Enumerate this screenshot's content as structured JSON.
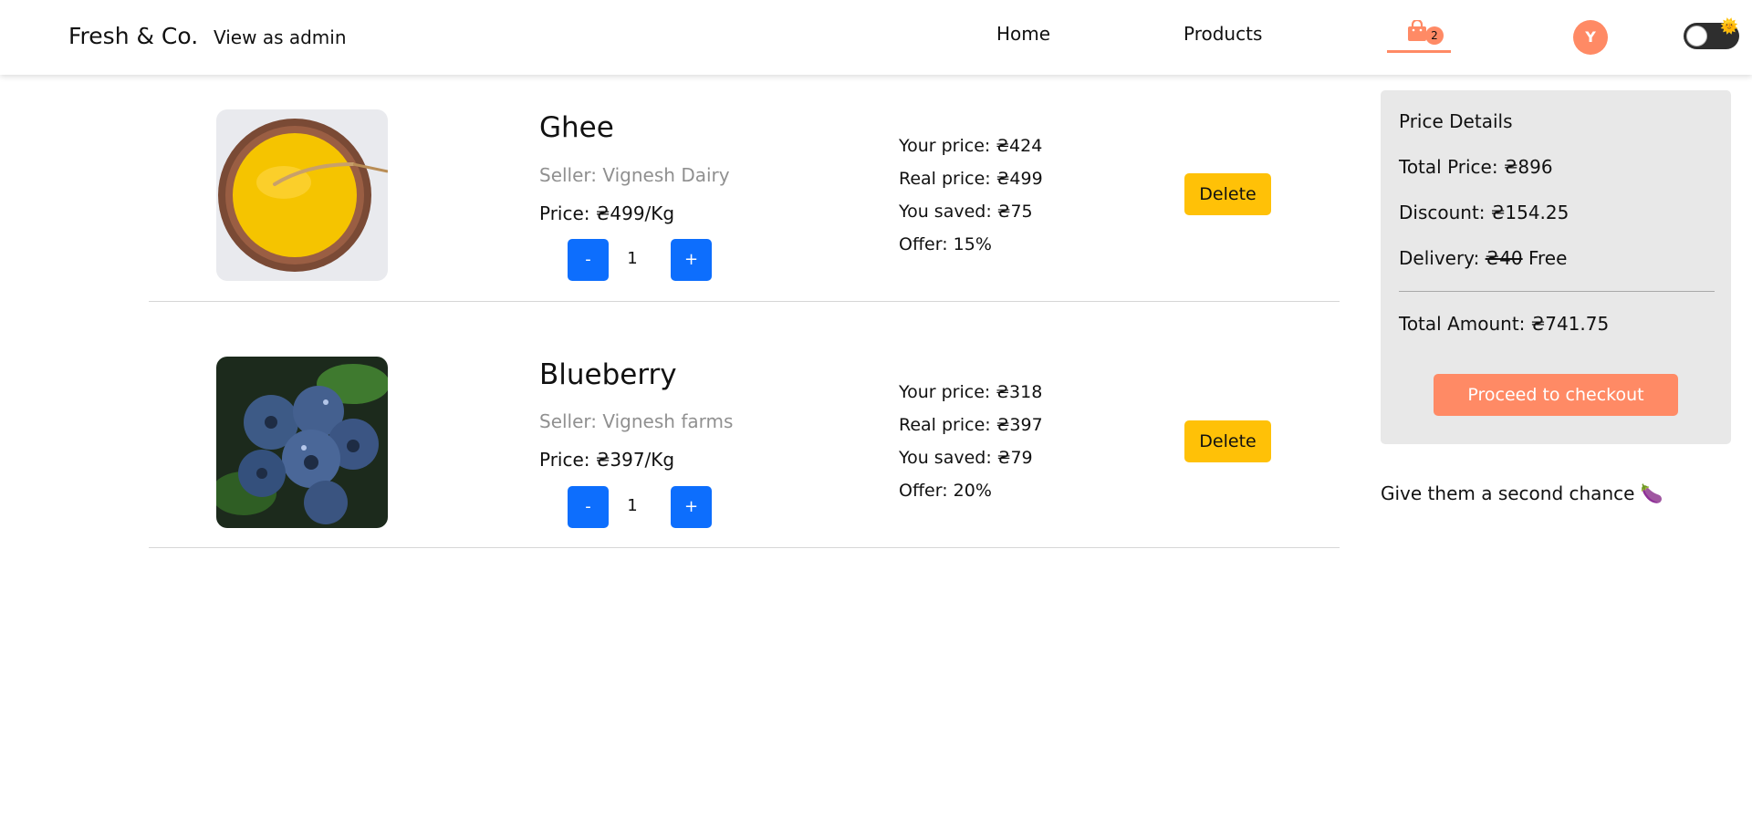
{
  "header": {
    "brand": "Fresh & Co.",
    "admin_link": "View as admin",
    "nav": {
      "home": "Home",
      "products": "Products"
    },
    "cart_count": "2",
    "avatar_initial": "Y",
    "toggle_emoji": "🌞"
  },
  "cart": [
    {
      "name": "Ghee",
      "seller": "Seller: Vignesh Dairy",
      "unit_price": "Price: ₴499/Kg",
      "quantity": "1",
      "minus": "-",
      "plus": "+",
      "your_price": "Your price: ₴424",
      "real_price": "Real price: ₴499",
      "you_saved": "You saved: ₴75",
      "offer": "Offer: 15%",
      "delete": "Delete"
    },
    {
      "name": "Blueberry",
      "seller": "Seller: Vignesh farms",
      "unit_price": "Price: ₴397/Kg",
      "quantity": "1",
      "minus": "-",
      "plus": "+",
      "your_price": "Your price: ₴318",
      "real_price": "Real price: ₴397",
      "you_saved": "You saved: ₴79",
      "offer": "Offer: 20%",
      "delete": "Delete"
    }
  ],
  "summary": {
    "title": "Price Details",
    "total_price": "Total Price: ₴896",
    "discount": "Discount: ₴154.25",
    "delivery_label": "Delivery:",
    "delivery_old": "₴40",
    "delivery_new": "Free",
    "total_amount": "Total Amount: ₴741.75",
    "checkout": "Proceed to checkout"
  },
  "second_chance": "Give them a second chance 🍆",
  "colors": {
    "accent": "#ff8a65",
    "primary_button": "#0d6efd",
    "delete_button": "#ffc107",
    "summary_bg": "#e8e8e8"
  },
  "icons": {
    "cart": "shopping-bag-icon",
    "toggle": "theme-toggle"
  }
}
